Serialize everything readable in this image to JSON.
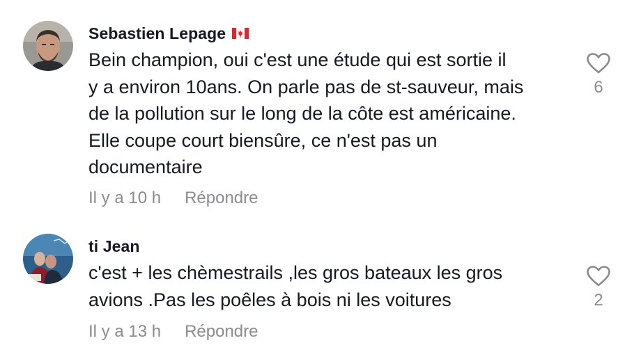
{
  "comments": [
    {
      "username": "Sebastien Lepage",
      "flag_icon": "canada-flag-icon",
      "text": "Bein champion, oui c'est une étude qui est sortie il\ny a environ 10ans. On parle pas de st-sauveur, mais\nde la pollution sur le long de la côte est américaine.\nElle coupe court biensûre, ce n'est pas un\ndocumentaire",
      "time": "Il y a 10 h",
      "reply_label": "Répondre",
      "likes": "6"
    },
    {
      "username": "ti Jean",
      "text": "c'est + les chèmestrails ,les gros bateaux les gros\navions .Pas les poêles à bois ni les voitures",
      "time": "Il y a 13 h",
      "reply_label": "Répondre",
      "likes": "2"
    }
  ],
  "colors": {
    "text": "#161823",
    "secondary": "#8a8b91",
    "flag_red": "#e3242b"
  }
}
